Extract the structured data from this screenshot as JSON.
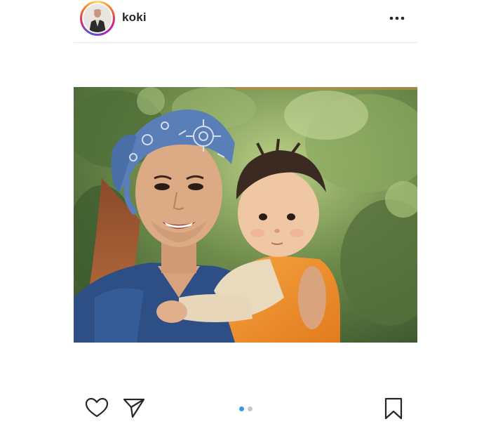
{
  "post": {
    "username": "koki",
    "carousel": {
      "total": 2,
      "active": 1
    }
  },
  "icons": {
    "avatar": "profile-avatar",
    "more": "more-options-icon",
    "like": "heart-icon",
    "share": "paper-plane-icon",
    "save": "bookmark-icon"
  },
  "colors": {
    "text": "#262626",
    "divider": "#e6e6e6",
    "active_dot": "#3897f0",
    "inactive_dot": "#c7c7c7"
  }
}
